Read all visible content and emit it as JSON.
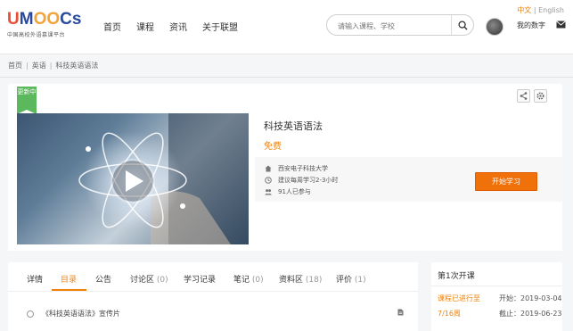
{
  "header": {
    "logo_text": "UMOOCs",
    "logo_sub": "中国高校外语慕课平台",
    "nav": [
      "首页",
      "课程",
      "资讯",
      "关于联盟"
    ],
    "lang_cn": "中文",
    "lang_sep": "|",
    "lang_en": "English",
    "search_placeholder": "请输入课程、学校",
    "my_learning": "我的数字"
  },
  "breadcrumb": [
    "首页",
    "英语",
    "科技英语语法"
  ],
  "course": {
    "badge": "更新中",
    "title": "科技英语语法",
    "price": "免费",
    "school": "西安电子科技大学",
    "time": "建议每周学习2-3小时",
    "participants": "91人已参与",
    "start_button": "开始学习"
  },
  "tabs": [
    {
      "label": "详情",
      "count": ""
    },
    {
      "label": "目录",
      "count": ""
    },
    {
      "label": "公告",
      "count": ""
    },
    {
      "label": "讨论区",
      "count": "(0)"
    },
    {
      "label": "学习记录",
      "count": ""
    },
    {
      "label": "笔记",
      "count": "(0)"
    },
    {
      "label": "资料区",
      "count": "(18)"
    },
    {
      "label": "评价",
      "count": "(1)"
    }
  ],
  "catalog": {
    "first_item": "《科技英语语法》宣传片"
  },
  "session": {
    "title": "第1次开课",
    "progress_label": "课程已进行至",
    "progress_week": "7/16周",
    "start_label": "开始：",
    "start_date": "2019-03-04",
    "end_label": "截止：",
    "end_date": "2019-06-23"
  },
  "colors": {
    "accent": "#f0820a",
    "badge": "#5cb85c",
    "button": "#f0700a"
  }
}
